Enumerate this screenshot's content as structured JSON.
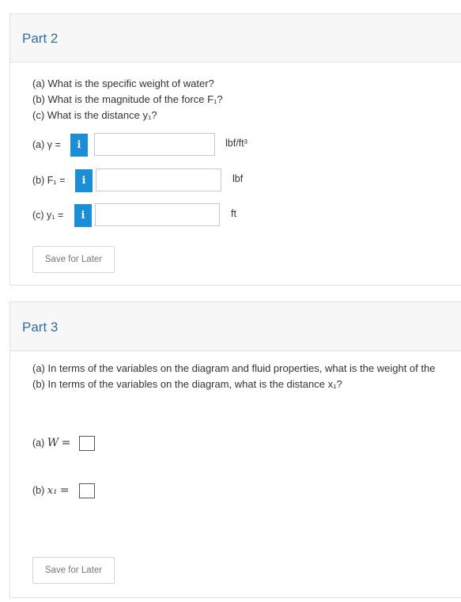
{
  "part2": {
    "title": "Part 2",
    "questions": [
      "(a) What is the specific weight of water?",
      "(b) What is the magnitude of the force F₁?",
      "(c) What is the distance y₁?"
    ],
    "answers": [
      {
        "label": "(a) γ =",
        "info": "i",
        "value": "",
        "unit": "lbf/ft³"
      },
      {
        "label": "(b) F₁ =",
        "info": "i",
        "value": "",
        "unit": "lbf"
      },
      {
        "label": "(c) y₁ =",
        "info": "i",
        "value": "",
        "unit": "ft"
      }
    ],
    "save_label": "Save for Later"
  },
  "part3": {
    "title": "Part 3",
    "questions": [
      "(a) In terms of the variables on the diagram and fluid properties, what is the weight of the",
      "(b) In terms of the variables on the diagram, what is the distance x₁?"
    ],
    "answers": [
      {
        "prefix": "(a)",
        "var": "W",
        "eq": "="
      },
      {
        "prefix": "(b)",
        "var": "x₁",
        "eq": "="
      }
    ],
    "save_label": "Save for Later"
  },
  "colors": {
    "accent": "#2f6f9f",
    "info_button": "#1a8fd8",
    "header_bg": "#f7f7f7",
    "border": "#e1e1e1"
  }
}
